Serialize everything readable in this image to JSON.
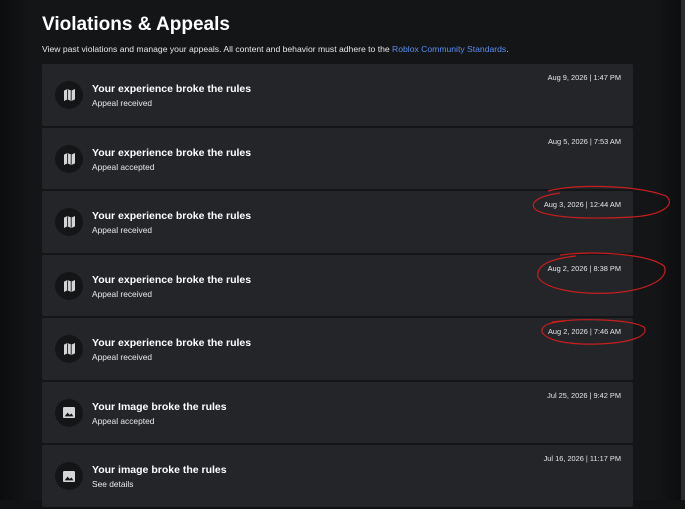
{
  "page": {
    "title": "Violations & Appeals",
    "description": "View past violations and manage your appeals. All content and behavior must adhere to the",
    "link_text": "Roblox Community Standards",
    "description_end": "."
  },
  "colors": {
    "background": "#141517",
    "card": "#232529",
    "link": "#5a8ef0",
    "annotation": "#c81e1e"
  },
  "violations": [
    {
      "icon": "map-icon",
      "title": "Your experience broke the rules",
      "status": "Appeal received",
      "time": "Aug 9, 2026 | 1:47 PM"
    },
    {
      "icon": "map-icon",
      "title": "Your experience broke the rules",
      "status": "Appeal accepted",
      "time": "Aug 5, 2026 | 7:53 AM"
    },
    {
      "icon": "map-icon",
      "title": "Your experience broke the rules",
      "status": "Appeal received",
      "time": "Aug 3, 2026 | 12:44 AM"
    },
    {
      "icon": "map-icon",
      "title": "Your experience broke the rules",
      "status": "Appeal received",
      "time": "Aug 2, 2026 | 8:38 PM"
    },
    {
      "icon": "map-icon",
      "title": "Your experience broke the rules",
      "status": "Appeal received",
      "time": "Aug 2, 2026 | 7:46 AM"
    },
    {
      "icon": "image-icon",
      "title": "Your Image broke the rules",
      "status": "Appeal accepted",
      "time": "Jul 25, 2026 | 9:42 PM"
    },
    {
      "icon": "image-icon",
      "title": "Your image broke the rules",
      "status": "See details",
      "time": "Jul 16, 2026 | 11:17 PM"
    }
  ]
}
